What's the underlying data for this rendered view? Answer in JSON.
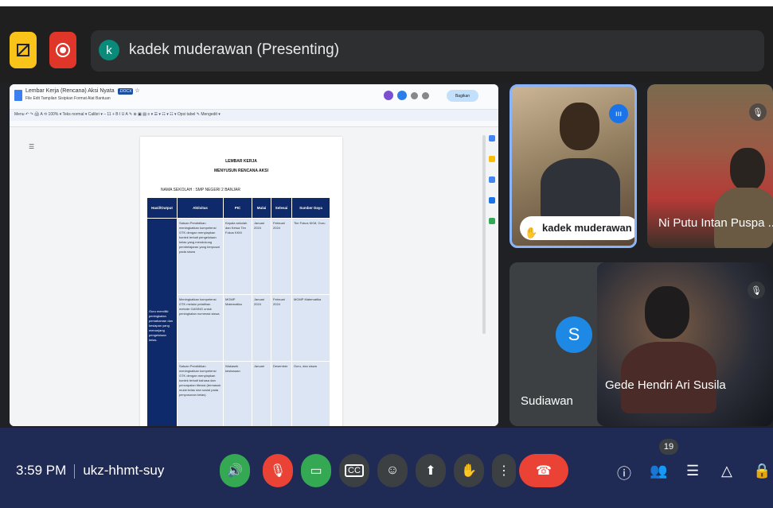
{
  "presenter": {
    "initial": "k",
    "title": "kadek muderawan (Presenting)"
  },
  "doc": {
    "title": "Lembar Kerja (Rencana) Aksi Nyata",
    "badge": ".DOCX",
    "menus": "File  Edit  Tampilan  Sisipkan  Format  Alat  Bantuan",
    "share_label": "Bagikan",
    "toolbar_text": "Menu   ↶ ↷ 🖨 A ⟲  100%  ▾   Teks normal  ▾   Calibri  ▾   –  11  +   B  I  U  A  ✎   ⊕ ▣ ▤   ≡ ▾  ☰ ▾  ☷ ▾  ☷ ▾       Opsi tabel        ✎ Mengedit ▾",
    "heading1": "LEMBAR KERJA",
    "heading2": "MENYUSUN RENCANA AKSI",
    "school": "NAMA SEKOLAH : SMP NEGERI 2 BANJAR",
    "table": {
      "headers": [
        "Hasil/Output",
        "Aktivitas",
        "PIC",
        "Mulai",
        "Selesai",
        "Sumber Daya"
      ],
      "side_text": "Guru memiliki peningkatan pemahaman dan kesiapan yang menunjang pengelolaan kelas.",
      "rows": [
        [
          "Satuan Pendidikan meningkatkan kompetensi GTK dengan menyiapkan kontek terkait pengelolaan kelas yang mendukung pembelajaran yang berpusat pada siswa",
          "Kepala sekolah dan Ketua Tim Fokus KKM",
          "Januari 2024",
          "Februari 2024",
          "Tim Fokus KKM, Guru"
        ],
        [
          "Meningkatkan kompetensi GTK melalui pelatihan metode GASING untuk peningkatan numerasi siswa",
          "MGMP Matematika",
          "Januari 2024",
          "Februari 2024",
          "MGMP Matematika"
        ],
        [
          "Satuan Pendidikan meningkatkan kompetensi GTK dengan menyiapkan kontek terkait bahasa dan pencapaian literasi (termasuk mulai kelas dan sosial pada penyusunan kelas)",
          "Wakasek kesiswaan",
          "Januari",
          "Desember",
          "Guru, dan siswa"
        ]
      ]
    }
  },
  "participants": [
    {
      "name": "kadek muderawan",
      "hand_raised": true,
      "speaking": true
    },
    {
      "name": "Ni Putu Intan Puspa ...",
      "muted": true
    },
    {
      "name": "Sudiawan",
      "initial": "S",
      "avatar_color": "#1e88e5"
    },
    {
      "name": "Gede Hendri Ari Susila",
      "muted": true
    }
  ],
  "bottom": {
    "time": "3:59 PM",
    "meeting_code": "ukz-hhmt-suy",
    "people_count": "19"
  },
  "colors": {
    "accent": "#8ab4f8",
    "bar": "#1f2a55",
    "hangup": "#ea4335"
  }
}
